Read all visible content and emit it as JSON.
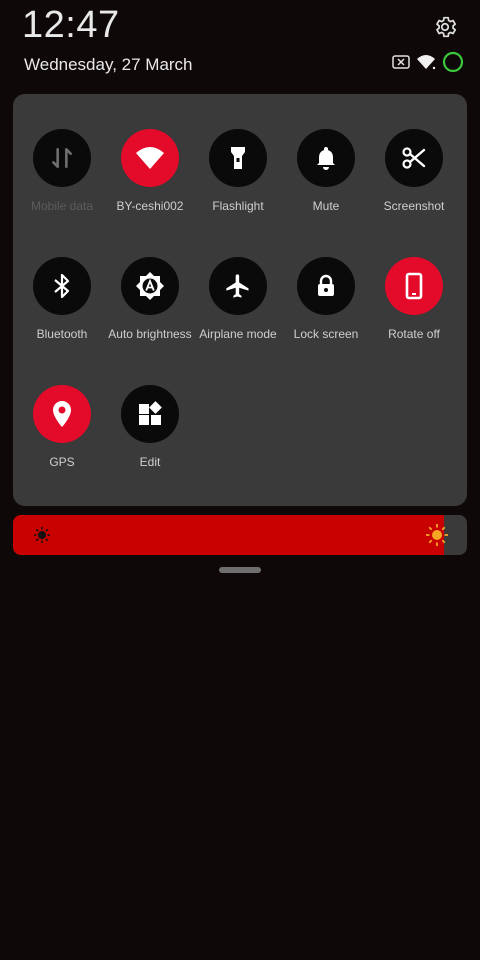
{
  "status": {
    "time": "12:47",
    "date": "Wednesday, 27 March"
  },
  "colors": {
    "panel_bg": "#3a3a3a",
    "tile_inactive": "#0a0a0a",
    "tile_active": "#e30a2a",
    "brightness_fill": "#c80000",
    "sun_color": "#f5a623",
    "battery_ring": "#3cc83c"
  },
  "tiles": [
    {
      "label": "Mobile data",
      "icon": "mobile-data-icon",
      "active": false,
      "dim": true
    },
    {
      "label": "BY-ceshi002",
      "icon": "wifi-icon",
      "active": true,
      "dim": false
    },
    {
      "label": "Flashlight",
      "icon": "flashlight-icon",
      "active": false,
      "dim": false
    },
    {
      "label": "Mute",
      "icon": "bell-icon",
      "active": false,
      "dim": false
    },
    {
      "label": "Screenshot",
      "icon": "scissors-icon",
      "active": false,
      "dim": false
    },
    {
      "label": "Bluetooth",
      "icon": "bluetooth-icon",
      "active": false,
      "dim": false
    },
    {
      "label": "Auto brightness",
      "icon": "auto-brightness-icon",
      "active": false,
      "dim": false
    },
    {
      "label": "Airplane mode",
      "icon": "airplane-icon",
      "active": false,
      "dim": false
    },
    {
      "label": "Lock screen",
      "icon": "lock-icon",
      "active": false,
      "dim": false
    },
    {
      "label": "Rotate off",
      "icon": "rotate-lock-icon",
      "active": true,
      "dim": false
    },
    {
      "label": "GPS",
      "icon": "location-pin-icon",
      "active": true,
      "dim": false
    },
    {
      "label": "Edit",
      "icon": "grid-edit-icon",
      "active": false,
      "dim": false
    }
  ],
  "brightness": {
    "level": 0.95
  }
}
